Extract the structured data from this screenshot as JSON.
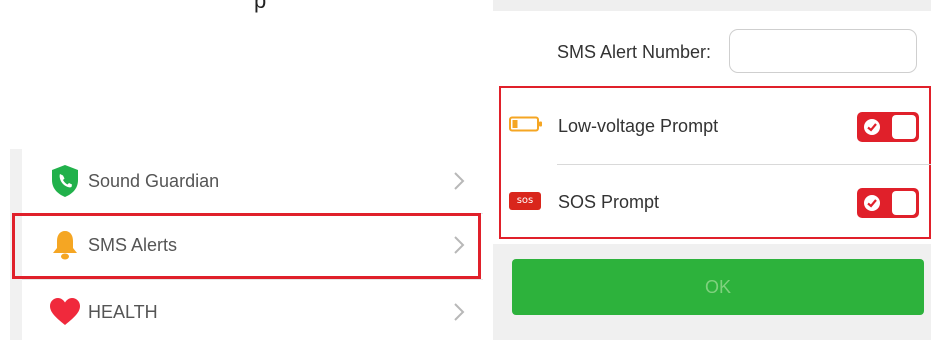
{
  "top_fragment": "p",
  "menu": {
    "items": [
      {
        "label": "Sound Guardian",
        "icon": "phone-shield-icon"
      },
      {
        "label": "SMS Alerts",
        "icon": "bell-icon"
      },
      {
        "label": "HEALTH",
        "icon": "heart-icon"
      }
    ]
  },
  "sms_settings": {
    "alert_number_label": "SMS Alert Number:",
    "alert_number_value": "",
    "prompts": [
      {
        "label": "Low-voltage Prompt",
        "icon": "battery-low-icon",
        "enabled": true
      },
      {
        "label": "SOS Prompt",
        "icon": "sos-icon",
        "badge_text": "SOS",
        "enabled": true
      }
    ],
    "ok_label": "OK"
  },
  "colors": {
    "highlight_red": "#e0202a",
    "toggle_red": "#e0202a",
    "ok_green": "#2db23c",
    "shield_green": "#21b14b",
    "bell_orange": "#f5a623",
    "heart_red": "#f0293c"
  }
}
